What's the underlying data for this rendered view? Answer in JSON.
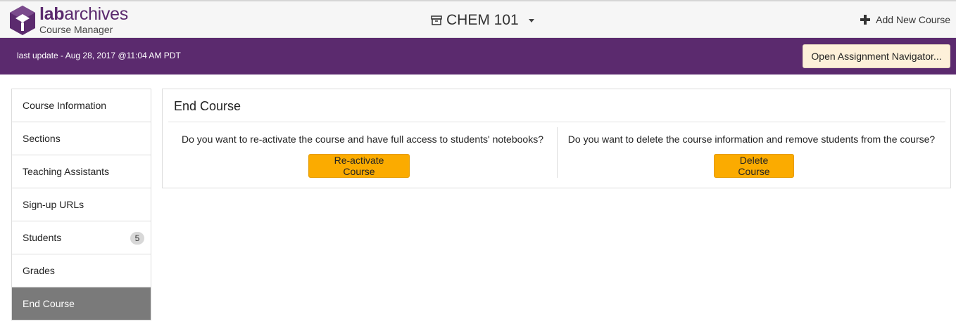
{
  "header": {
    "brand_bold": "lab",
    "brand_rest": "archives",
    "brand_sub": "Course Manager",
    "course_title": "CHEM 101",
    "course_icon": "archive-box-icon",
    "add_course_label": "Add New Course",
    "add_icon": "plus-icon"
  },
  "banner": {
    "last_update": "last update - Aug 28, 2017 @11:04 AM PDT",
    "navigator_button": "Open Assignment Navigator..."
  },
  "sidebar": {
    "items": [
      {
        "label": "Course Information"
      },
      {
        "label": "Sections"
      },
      {
        "label": "Teaching Assistants"
      },
      {
        "label": "Sign-up URLs"
      },
      {
        "label": "Students",
        "badge": "5"
      },
      {
        "label": "Grades"
      },
      {
        "label": "End Course",
        "active": true
      }
    ]
  },
  "panel": {
    "title": "End Course",
    "reactivate_question": "Do you want to re-activate the course and have full access to students' notebooks?",
    "reactivate_button": "Re-activate Course",
    "delete_question": "Do you want to delete the course information and remove students from the course?",
    "delete_button": "Delete Course"
  },
  "colors": {
    "brand_purple": "#5b2a6e",
    "action_orange": "#fbab00",
    "navigator_bg": "#fdf0d9",
    "active_item": "#7a7a7a"
  }
}
